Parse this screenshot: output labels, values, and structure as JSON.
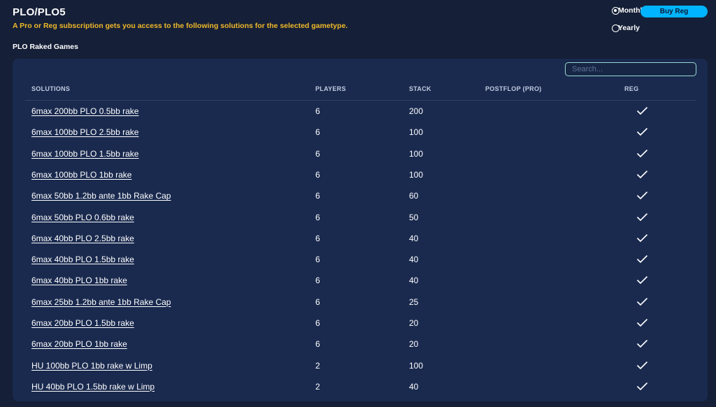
{
  "header": {
    "title": "PLO/PLO5",
    "subtitle": "A Pro or Reg subscription gets you access to the following solutions for the selected gametype.",
    "section_label": "PLO Raked Games"
  },
  "billing": {
    "monthly_label": "Monthly",
    "yearly_label": "Yearly",
    "buy_label": "Buy Reg",
    "selected": "monthly"
  },
  "search": {
    "placeholder": "Search..."
  },
  "table": {
    "columns": [
      "SOLUTIONS",
      "PLAYERS",
      "STACK",
      "POSTFLOP (PRO)",
      "REG"
    ],
    "rows": [
      {
        "name": "6max 200bb PLO 0.5bb rake",
        "players": "6",
        "stack": "200"
      },
      {
        "name": "6max 100bb PLO 2.5bb rake",
        "players": "6",
        "stack": "100"
      },
      {
        "name": "6max 100bb PLO 1.5bb rake",
        "players": "6",
        "stack": "100"
      },
      {
        "name": "6max 100bb PLO 1bb rake",
        "players": "6",
        "stack": "100"
      },
      {
        "name": "6max 50bb 1.2bb ante 1bb Rake Cap",
        "players": "6",
        "stack": "60"
      },
      {
        "name": "6max 50bb PLO 0.6bb rake",
        "players": "6",
        "stack": "50"
      },
      {
        "name": "6max 40bb PLO 2.5bb rake",
        "players": "6",
        "stack": "40"
      },
      {
        "name": "6max 40bb PLO 1.5bb rake",
        "players": "6",
        "stack": "40"
      },
      {
        "name": "6max 40bb PLO 1bb rake",
        "players": "6",
        "stack": "40"
      },
      {
        "name": "6max 25bb 1.2bb ante 1bb Rake Cap",
        "players": "6",
        "stack": "25"
      },
      {
        "name": "6max 20bb PLO 1.5bb rake",
        "players": "6",
        "stack": "20"
      },
      {
        "name": "6max 20bb PLO 1bb rake",
        "players": "6",
        "stack": "20"
      },
      {
        "name": "HU 100bb PLO 1bb rake w Limp",
        "players": "2",
        "stack": "100"
      },
      {
        "name": "HU 40bb PLO 1.5bb rake w Limp",
        "players": "2",
        "stack": "40"
      }
    ],
    "reg_icon": "check-icon"
  },
  "colors": {
    "background": "#151f37",
    "panel": "#1a2a4f",
    "accent": "#00b4ff",
    "subtitle": "#f0b929"
  }
}
